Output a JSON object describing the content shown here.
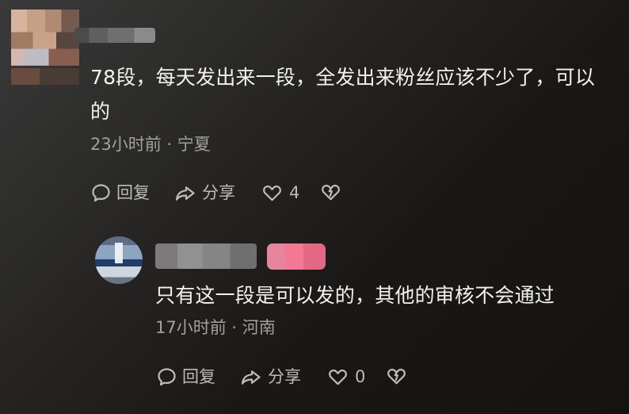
{
  "comments": [
    {
      "author": "",
      "text": "78段，每天发出来一段，全发出来粉丝应该不少了，可以的",
      "meta": "23小时前 · 宁夏",
      "actions": {
        "reply_label": "回复",
        "share_label": "分享",
        "like_count": "4"
      },
      "icons": {
        "reply": "speech-bubble-icon",
        "share": "share-arrow-icon",
        "like": "heart-outline-icon",
        "dislike": "broken-heart-icon"
      }
    },
    {
      "author": "",
      "text": "只有这一段是可以发的，其他的审核不会通过",
      "meta": "17小时前 · 河南",
      "actions": {
        "reply_label": "回复",
        "share_label": "分享",
        "like_count": "0"
      },
      "icons": {
        "reply": "speech-bubble-icon",
        "share": "share-arrow-icon",
        "like": "heart-outline-icon",
        "dislike": "broken-heart-icon"
      }
    }
  ],
  "colors": {
    "background_start": "#3a3a3a",
    "background_end": "#151311",
    "primary_text": "#f2f2f2",
    "secondary_text": "#a1a1a1",
    "action_text": "#bbbbbb",
    "badge_pink": "#ff7d9b"
  }
}
